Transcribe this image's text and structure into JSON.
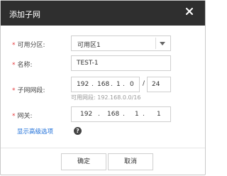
{
  "dialog": {
    "title": "添加子网",
    "close_icon": "close-icon"
  },
  "fields": {
    "zone": {
      "label": "可用分区:",
      "value": "可用区1"
    },
    "name": {
      "label": "名称:",
      "value": "TEST-1"
    },
    "segment": {
      "label": "子网网段:",
      "octets": [
        "192",
        "168",
        "1",
        "0"
      ],
      "separator": "/",
      "mask": "24",
      "hint": "可用网段: 192.168.0.0/16"
    },
    "gateway": {
      "label": "网关:",
      "octets": [
        "192",
        "168",
        "1",
        "1"
      ]
    }
  },
  "star": "*",
  "advanced": {
    "label": "显示高级选项",
    "icon": "help-icon"
  },
  "footer": {
    "confirm": "确定",
    "cancel": "取消"
  },
  "colors": {
    "titlebar": "#2f2f2f",
    "required": "#e4393c",
    "link": "#1e6fd9"
  }
}
